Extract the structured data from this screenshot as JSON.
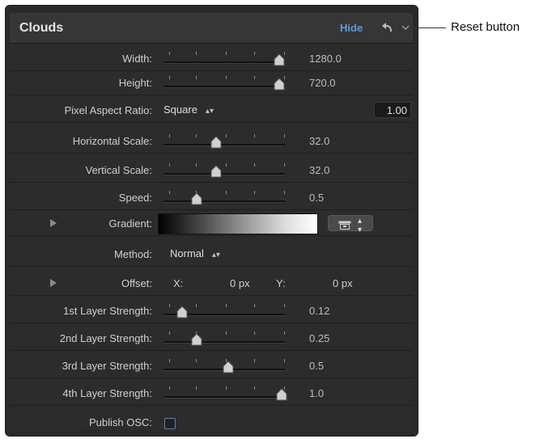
{
  "panel": {
    "title": "Clouds",
    "hide_label": "Hide",
    "reset_icon": "reset-arrow-icon",
    "chevron_icon": "chevron-icon"
  },
  "rows": [
    {
      "label": "Width:",
      "value": "1280.0",
      "level": 0.95
    },
    {
      "label": "Height:",
      "value": "720.0",
      "level": 0.95
    },
    {
      "label": "Pixel Aspect Ratio:",
      "popup": "Square",
      "box_value": "1.00"
    },
    {
      "label": "Horizontal Scale:",
      "value": "32.0",
      "level": 0.43
    },
    {
      "label": "Vertical Scale:",
      "value": "32.0",
      "level": 0.43
    },
    {
      "label": "Speed:",
      "value": "0.5",
      "level": 0.27
    },
    {
      "label": "Gradient:",
      "preset_icon": "gradient-preset-icon"
    },
    {
      "label": "Method:",
      "popup": "Normal"
    },
    {
      "label": "Offset:",
      "x_label": "X:",
      "x_value": "0 px",
      "y_label": "Y:",
      "y_value": "0 px"
    },
    {
      "label": "1st Layer Strength:",
      "value": "0.12",
      "level": 0.15
    },
    {
      "label": "2nd Layer Strength:",
      "value": "0.25",
      "level": 0.27
    },
    {
      "label": "3rd Layer Strength:",
      "value": "0.5",
      "level": 0.53
    },
    {
      "label": "4th Layer Strength:",
      "value": "1.0",
      "level": 0.97
    },
    {
      "label": "Publish OSC:",
      "checked": false
    }
  ],
  "callout": {
    "text": "Reset button"
  },
  "colors": {
    "accent": "#5b9bdc",
    "panel_bg": "#2c2c2c"
  }
}
